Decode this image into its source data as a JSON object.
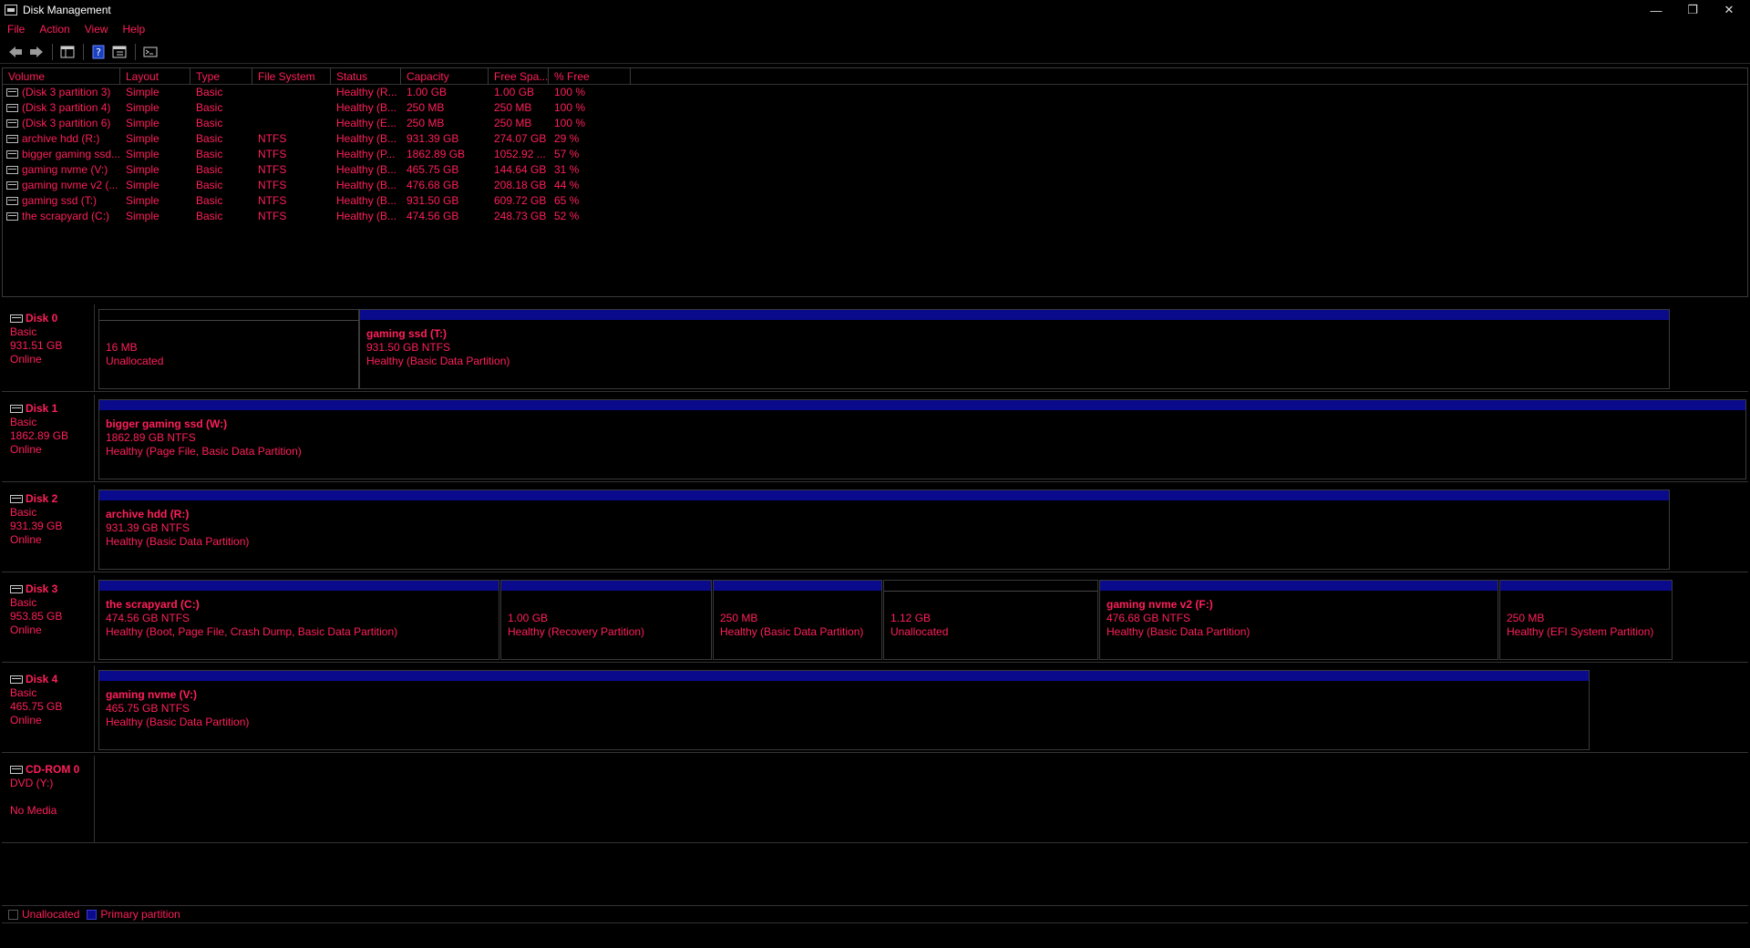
{
  "window": {
    "title": "Disk Management",
    "controls": {
      "minimize": "—",
      "restore": "❐",
      "close": "✕"
    }
  },
  "menu": [
    "File",
    "Action",
    "View",
    "Help"
  ],
  "toolbar": {
    "icons": [
      "back-arrow-icon",
      "forward-arrow-icon",
      "console-tree-icon",
      "help-icon",
      "properties-icon",
      "console-icon"
    ]
  },
  "volume_list": {
    "columns": [
      "Volume",
      "Layout",
      "Type",
      "File System",
      "Status",
      "Capacity",
      "Free Spa...",
      "% Free"
    ],
    "rows": [
      [
        "(Disk 3 partition 3)",
        "Simple",
        "Basic",
        "",
        "Healthy (R...",
        "1.00 GB",
        "1.00 GB",
        "100 %"
      ],
      [
        "(Disk 3 partition 4)",
        "Simple",
        "Basic",
        "",
        "Healthy (B...",
        "250 MB",
        "250 MB",
        "100 %"
      ],
      [
        "(Disk 3 partition 6)",
        "Simple",
        "Basic",
        "",
        "Healthy (E...",
        "250 MB",
        "250 MB",
        "100 %"
      ],
      [
        "archive hdd (R:)",
        "Simple",
        "Basic",
        "NTFS",
        "Healthy (B...",
        "931.39 GB",
        "274.07 GB",
        "29 %"
      ],
      [
        "bigger gaming ssd...",
        "Simple",
        "Basic",
        "NTFS",
        "Healthy (P...",
        "1862.89 GB",
        "1052.92 ...",
        "57 %"
      ],
      [
        "gaming nvme (V:)",
        "Simple",
        "Basic",
        "NTFS",
        "Healthy (B...",
        "465.75 GB",
        "144.64 GB",
        "31 %"
      ],
      [
        "gaming nvme v2 (...",
        "Simple",
        "Basic",
        "NTFS",
        "Healthy (B...",
        "476.68 GB",
        "208.18 GB",
        "44 %"
      ],
      [
        "gaming ssd (T:)",
        "Simple",
        "Basic",
        "NTFS",
        "Healthy (B...",
        "931.50 GB",
        "609.72 GB",
        "65 %"
      ],
      [
        "the scrapyard (C:)",
        "Simple",
        "Basic",
        "NTFS",
        "Healthy (B...",
        "474.56 GB",
        "248.73 GB",
        "52 %"
      ]
    ]
  },
  "disks": [
    {
      "name": "Disk 0",
      "type": "Basic",
      "size": "931.51 GB",
      "state": "Online",
      "partitions": [
        {
          "kind": "unallocated",
          "vname": "",
          "line1": "16 MB",
          "line2": "Unallocated"
        },
        {
          "kind": "primary",
          "vname": "gaming ssd  (T:)",
          "line1": "931.50 GB NTFS",
          "line2": "Healthy (Basic Data Partition)"
        }
      ]
    },
    {
      "name": "Disk 1",
      "type": "Basic",
      "size": "1862.89 GB",
      "state": "Online",
      "partitions": [
        {
          "kind": "primary",
          "vname": "bigger gaming ssd  (W:)",
          "line1": "1862.89 GB NTFS",
          "line2": "Healthy (Page File, Basic Data Partition)"
        }
      ]
    },
    {
      "name": "Disk 2",
      "type": "Basic",
      "size": "931.39 GB",
      "state": "Online",
      "partitions": [
        {
          "kind": "primary",
          "vname": "archive hdd  (R:)",
          "line1": "931.39 GB NTFS",
          "line2": "Healthy (Basic Data Partition)"
        }
      ]
    },
    {
      "name": "Disk 3",
      "type": "Basic",
      "size": "953.85 GB",
      "state": "Online",
      "partitions": [
        {
          "kind": "primary",
          "vname": "the scrapyard  (C:)",
          "line1": "474.56 GB NTFS",
          "line2": "Healthy (Boot, Page File, Crash Dump, Basic Data Partition)"
        },
        {
          "kind": "primary",
          "vname": "",
          "line1": "1.00 GB",
          "line2": "Healthy (Recovery Partition)"
        },
        {
          "kind": "primary",
          "vname": "",
          "line1": "250 MB",
          "line2": "Healthy (Basic Data Partition)"
        },
        {
          "kind": "unallocated",
          "vname": "",
          "line1": "1.12 GB",
          "line2": "Unallocated"
        },
        {
          "kind": "primary",
          "vname": "gaming nvme v2  (F:)",
          "line1": "476.68 GB NTFS",
          "line2": "Healthy (Basic Data Partition)"
        },
        {
          "kind": "primary",
          "vname": "",
          "line1": "250 MB",
          "line2": "Healthy (EFI System Partition)"
        }
      ]
    },
    {
      "name": "Disk 4",
      "type": "Basic",
      "size": "465.75 GB",
      "state": "Online",
      "partitions": [
        {
          "kind": "primary",
          "vname": "gaming nvme  (V:)",
          "line1": "465.75 GB NTFS",
          "line2": "Healthy (Basic Data Partition)"
        }
      ]
    }
  ],
  "cdrom": {
    "name": "CD-ROM 0",
    "drive": "DVD (Y:)",
    "media": "No Media"
  },
  "legend": {
    "unallocated": "Unallocated",
    "primary": "Primary partition"
  },
  "colors": {
    "text": "#ff1f5a",
    "primary_bar": "#0a0a8c",
    "background": "#000000"
  }
}
